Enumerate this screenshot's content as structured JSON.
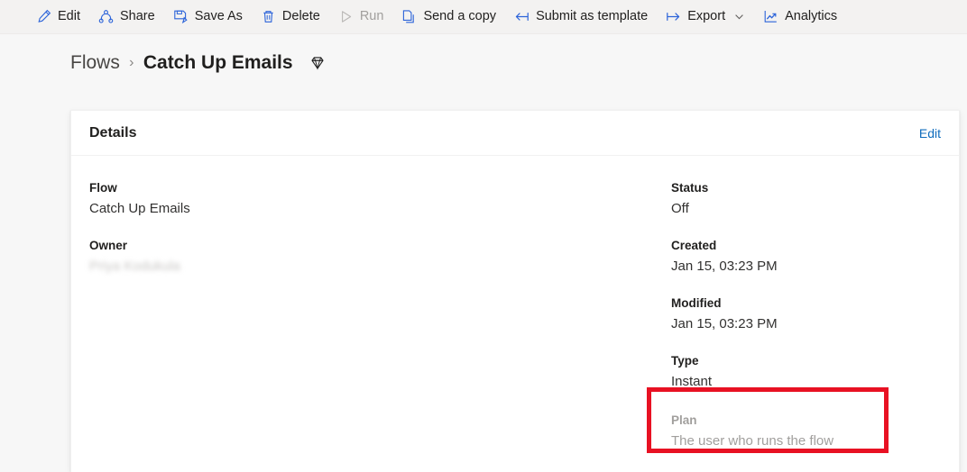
{
  "commandbar": {
    "items": [
      {
        "label": "Edit",
        "icon": "pencil-icon",
        "disabled": false,
        "chevron": false
      },
      {
        "label": "Share",
        "icon": "share-nodes-icon",
        "disabled": false,
        "chevron": false
      },
      {
        "label": "Save As",
        "icon": "save-as-icon",
        "disabled": false,
        "chevron": false
      },
      {
        "label": "Delete",
        "icon": "trash-icon",
        "disabled": false,
        "chevron": false
      },
      {
        "label": "Run",
        "icon": "play-icon",
        "disabled": true,
        "chevron": false
      },
      {
        "label": "Send a copy",
        "icon": "copy-icon",
        "disabled": false,
        "chevron": false
      },
      {
        "label": "Submit as template",
        "icon": "arrow-left-bar-icon",
        "disabled": false,
        "chevron": false
      },
      {
        "label": "Export",
        "icon": "arrow-right-bar-icon",
        "disabled": false,
        "chevron": true
      },
      {
        "label": "Analytics",
        "icon": "line-chart-icon",
        "disabled": false,
        "chevron": false
      }
    ]
  },
  "breadcrumb": {
    "root": "Flows",
    "separator": "›",
    "current": "Catch Up Emails",
    "badge_icon": "gem-icon"
  },
  "details_card": {
    "title": "Details",
    "edit_label": "Edit",
    "left_fields": [
      {
        "label": "Flow",
        "value": "Catch Up Emails",
        "redacted": false
      },
      {
        "label": "Owner",
        "value": "Priya Kodukula",
        "redacted": true
      }
    ],
    "right_fields": [
      {
        "label": "Status",
        "value": "Off"
      },
      {
        "label": "Created",
        "value": "Jan 15, 03:23 PM"
      },
      {
        "label": "Modified",
        "value": "Jan 15, 03:23 PM"
      },
      {
        "label": "Type",
        "value": "Instant"
      }
    ],
    "plan_field": {
      "label": "Plan",
      "value": "The user who runs the flow"
    }
  },
  "annotation": {
    "highlight_color": "#e81123"
  }
}
